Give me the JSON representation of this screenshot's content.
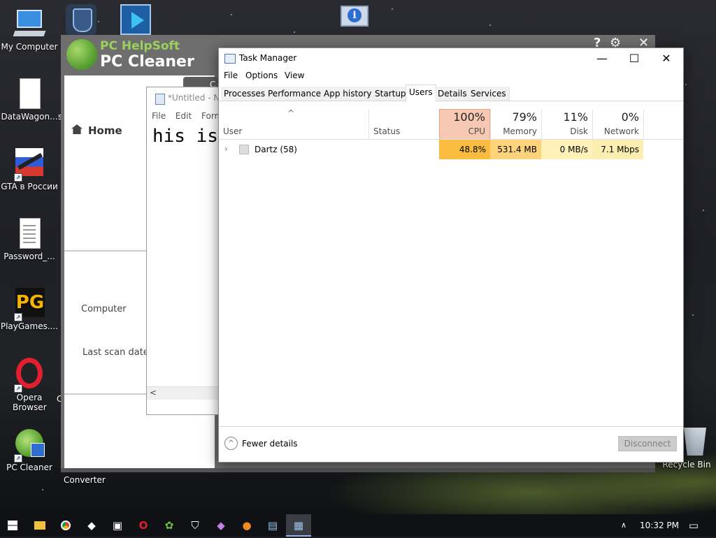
{
  "desktop": {
    "icons": [
      {
        "label": "My Computer"
      },
      {
        "label": "DataWagon..."
      },
      {
        "label": "GTA в России"
      },
      {
        "label": "Password_..."
      },
      {
        "label": "PlayGames...."
      },
      {
        "label": "Opera Browser"
      },
      {
        "label": "PC Cleaner"
      },
      {
        "label": "Converter"
      },
      {
        "label": "Recycle Bin"
      }
    ],
    "partial_labels": {
      "s": "s",
      "c": "C"
    }
  },
  "pc_cleaner": {
    "brand_top": "PC HelpSoft",
    "brand_bottom": "PC Cleaner",
    "home": "Home",
    "computer_label": "Computer",
    "last_scan_label": "Last scan date",
    "tab_partial": "C"
  },
  "notepad": {
    "title": "*Untitled - No",
    "menu": [
      "File",
      "Edit",
      "Form"
    ],
    "text": "his is",
    "scroll_left": "<"
  },
  "task_manager": {
    "title": "Task Manager",
    "window_controls": [
      "—",
      "☐",
      "✕"
    ],
    "menu": [
      "File",
      "Options",
      "View"
    ],
    "tabs": [
      "Processes",
      "Performance",
      "App history",
      "Startup",
      "Users",
      "Details",
      "Services"
    ],
    "active_tab": "Users",
    "columns": {
      "user": "User",
      "status": "Status",
      "cpu_pct": "100%",
      "cpu": "CPU",
      "memory_pct": "79%",
      "memory": "Memory",
      "disk_pct": "11%",
      "disk": "Disk",
      "network_pct": "0%",
      "network": "Network"
    },
    "rows": [
      {
        "user": "Dartz (58)",
        "status": "",
        "cpu": "48.8%",
        "memory": "531.4 MB",
        "disk": "0 MB/s",
        "network": "7.1 Mbps"
      }
    ],
    "fewer_details": "Fewer details",
    "disconnect": "Disconnect"
  },
  "taskbar": {
    "clock": "10:32 PM"
  },
  "colors": {
    "cpu_header": "#f7c9b4",
    "cpu_cell": "#f9bc3f",
    "memory_cell": "#fcd27a",
    "disk_cell": "#fff1b8",
    "network_cell": "#fbeeb0"
  }
}
